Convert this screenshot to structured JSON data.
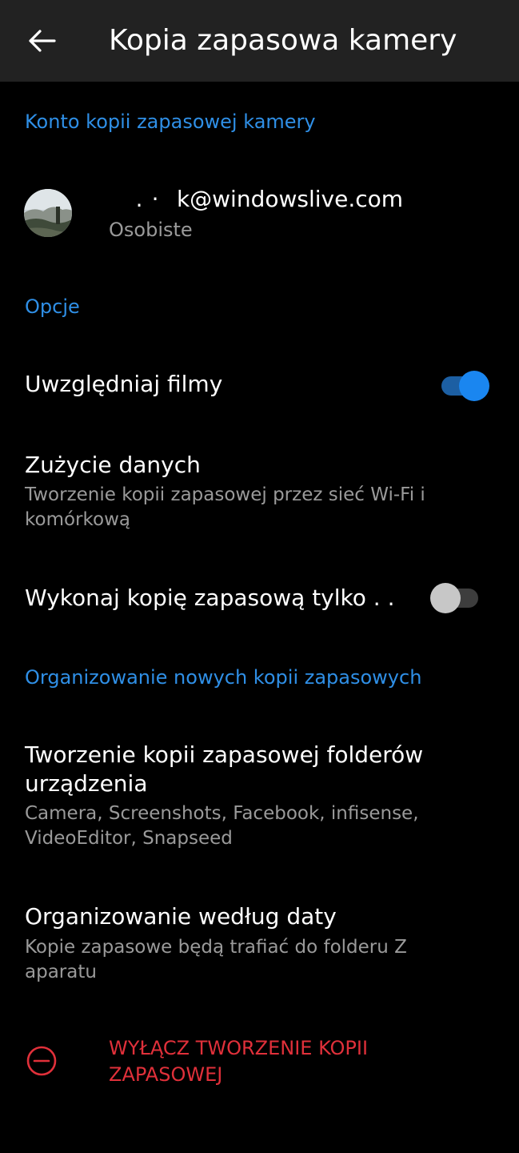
{
  "header": {
    "title": "Kopia zapasowa kamery",
    "back_icon": "arrow-left-icon"
  },
  "account_section": {
    "header": "Konto kopii zapasowej kamery",
    "email": "  .  ·    k@windowslive.com",
    "type": "Osobiste"
  },
  "options": {
    "header": "Opcje",
    "include_videos": {
      "label": "Uwzględniaj filmy",
      "enabled": true
    },
    "data_usage": {
      "label": "Zużycie danych",
      "value": "Tworzenie kopii zapasowej przez sieć Wi-Fi i komórkową"
    },
    "backup_only": {
      "label": "Wykonaj kopię zapasową tylko . .",
      "enabled": false
    }
  },
  "organize_section": {
    "header": "Organizowanie nowych kopii zapasowych",
    "device_folders": {
      "label": "Tworzenie kopii zapasowej folderów urządzenia",
      "value": "Camera, Screenshots, Facebook, infisense, VideoEditor, Snapseed"
    },
    "by_date": {
      "label": "Organizowanie według daty",
      "value": "Kopie zapasowe będą trafiać do folderu Z aparatu"
    }
  },
  "disable_backup": {
    "label": "WYŁĄCZ TWORZENIE KOPII ZAPASOWEJ",
    "icon": "minus-circle-icon"
  },
  "colors": {
    "accent": "#2f8fe6",
    "danger": "#e0303a",
    "toggle_on": "#1a86f0",
    "appbar": "#222222",
    "background": "#000000"
  }
}
